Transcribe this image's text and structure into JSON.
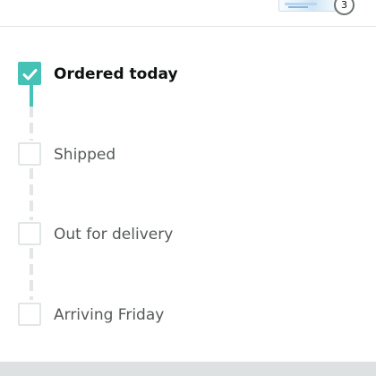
{
  "header": {
    "item_quantity": "3"
  },
  "tracker": {
    "progress_fraction": 0.25,
    "accent_color": "#45c1b5",
    "steps": [
      {
        "label": "Ordered today",
        "status": "completed",
        "icon": "check-icon"
      },
      {
        "label": "Shipped",
        "status": "pending"
      },
      {
        "label": "Out for delivery",
        "status": "pending"
      },
      {
        "label": "Arriving Friday",
        "status": "pending"
      }
    ]
  }
}
